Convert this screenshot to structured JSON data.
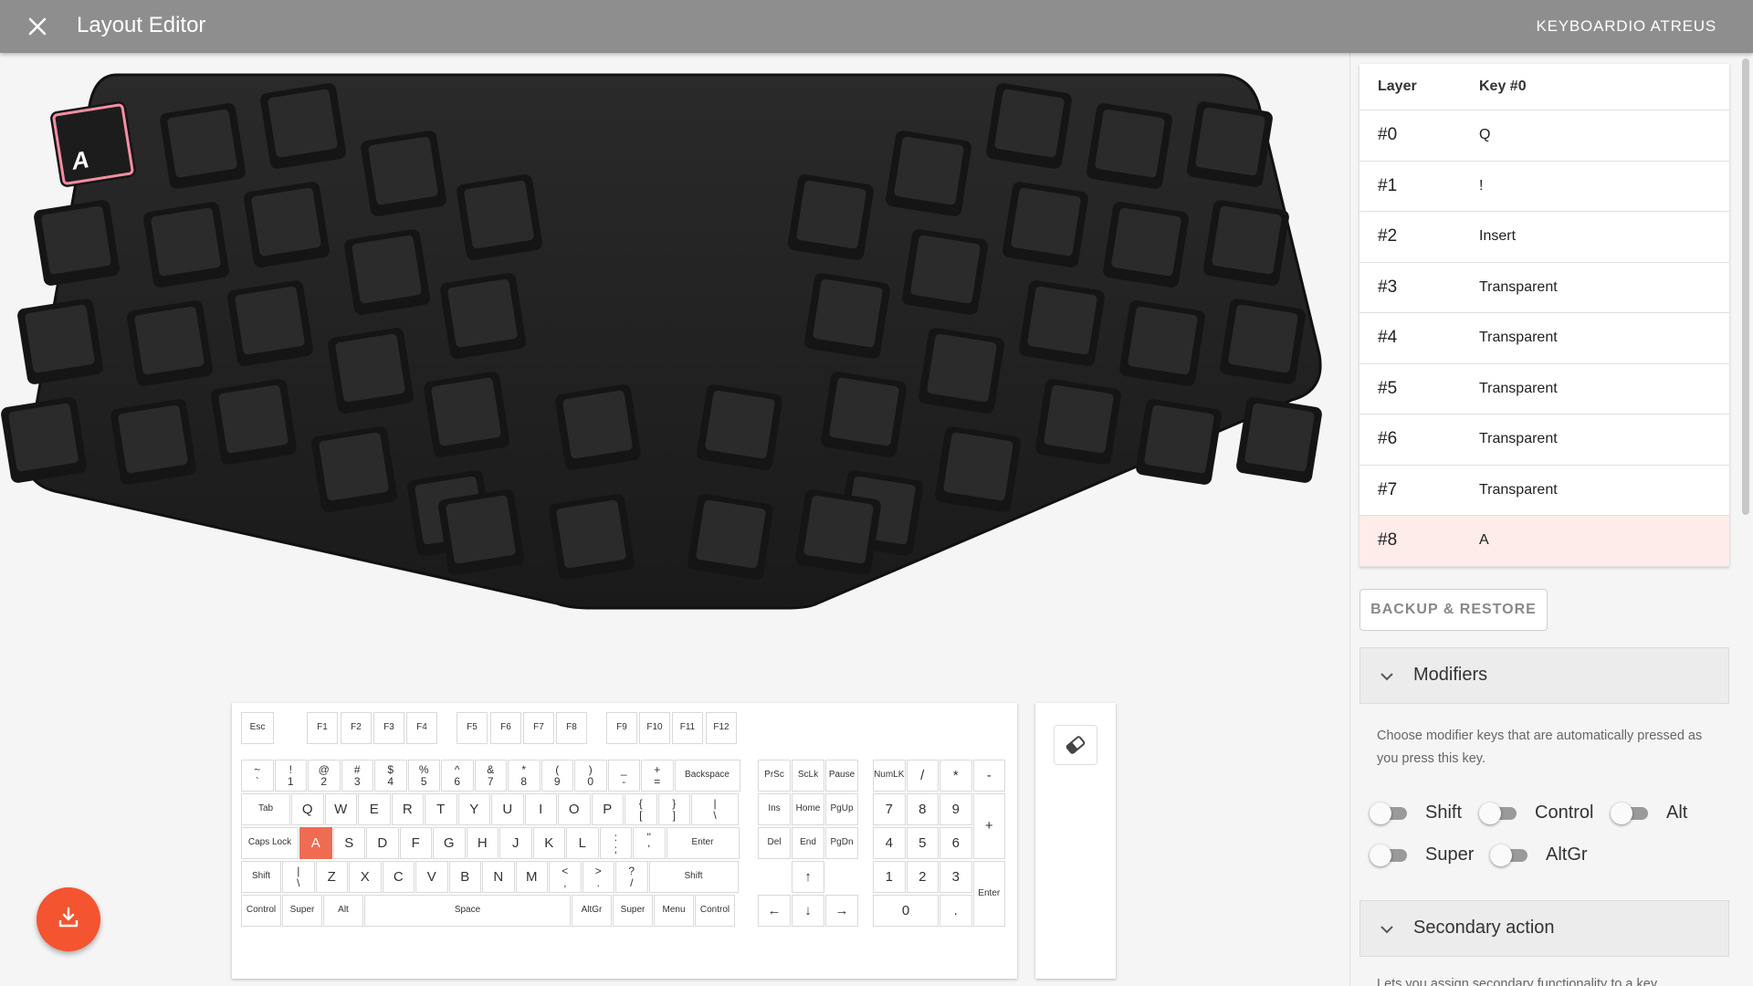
{
  "appbar": {
    "title": "Layout Editor",
    "device": "KEYBOARDIO ATREUS",
    "close_icon": "close-icon",
    "background": "#8e8e8e"
  },
  "layout_keyboard": {
    "selected_key_label": "A",
    "selected_key_color": "#f48fa0",
    "keycap_color": "#2b2b2b"
  },
  "key_selector": {
    "selected_key": "A",
    "accent": "#ef6c53",
    "function_row": [
      "Esc",
      "F1",
      "F2",
      "F3",
      "F4",
      "F5",
      "F6",
      "F7",
      "F8",
      "F9",
      "F10",
      "F11",
      "F12"
    ],
    "number_row": [
      [
        "~",
        "`"
      ],
      [
        "!",
        "1"
      ],
      [
        "@",
        "2"
      ],
      [
        "#",
        "3"
      ],
      [
        "$",
        "4"
      ],
      [
        "%",
        "5"
      ],
      [
        "^",
        "6"
      ],
      [
        "&",
        "7"
      ],
      [
        "*",
        "8"
      ],
      [
        "(",
        "9"
      ],
      [
        ")",
        "0"
      ],
      [
        "_",
        "-"
      ],
      [
        "+",
        "="
      ],
      "Backspace"
    ],
    "tab_row": [
      "Tab",
      "Q",
      "W",
      "E",
      "R",
      "T",
      "Y",
      "U",
      "I",
      "O",
      "P",
      [
        "{",
        "["
      ],
      [
        "}",
        "]"
      ],
      [
        "|",
        "\\"
      ]
    ],
    "caps_row": [
      "Caps Lock",
      "A",
      "S",
      "D",
      "F",
      "G",
      "H",
      "J",
      "K",
      "L",
      [
        ":",
        ";"
      ],
      [
        "\"",
        "'"
      ],
      "Enter"
    ],
    "shift_row": [
      "Shift",
      [
        "|",
        "\\"
      ],
      "Z",
      "X",
      "C",
      "V",
      "B",
      "N",
      "M",
      [
        "<",
        ","
      ],
      [
        ">",
        "."
      ],
      [
        "?",
        "/"
      ],
      "Shift"
    ],
    "bottom_row": [
      "Control",
      "Super",
      "Alt",
      "Space",
      "AltGr",
      "Super",
      "Menu",
      "Control"
    ],
    "nav_top": [
      "PrSc",
      "ScLk",
      "Pause"
    ],
    "nav_mid1": [
      "Ins",
      "Home",
      "PgUp"
    ],
    "nav_mid2": [
      "Del",
      "End",
      "PgDn"
    ],
    "arrows": [
      "↑",
      "←",
      "↓",
      "→"
    ],
    "numpad_row1": [
      "NumLK",
      "/",
      "*",
      "-"
    ],
    "numpad_row2": [
      "7",
      "8",
      "9"
    ],
    "numpad_row3": [
      "4",
      "5",
      "6"
    ],
    "numpad_plus": "+",
    "numpad_row4": [
      "1",
      "2",
      "3"
    ],
    "numpad_enter": "Enter",
    "numpad_row5": [
      "0",
      "."
    ]
  },
  "tools": {
    "eraser_icon": "eraser-icon"
  },
  "fab": {
    "icon": "download-icon",
    "color": "#f4542f"
  },
  "sidebar": {
    "table": {
      "headers": [
        "Layer",
        "Key #0"
      ],
      "rows": [
        {
          "layer": "#0",
          "key": "Q"
        },
        {
          "layer": "#1",
          "key": "!"
        },
        {
          "layer": "#2",
          "key": "Insert"
        },
        {
          "layer": "#3",
          "key": "Transparent"
        },
        {
          "layer": "#4",
          "key": "Transparent"
        },
        {
          "layer": "#5",
          "key": "Transparent"
        },
        {
          "layer": "#6",
          "key": "Transparent"
        },
        {
          "layer": "#7",
          "key": "Transparent"
        },
        {
          "layer": "#8",
          "key": "A",
          "selected": true
        }
      ]
    },
    "backup_label": "BACKUP & RESTORE",
    "modifiers": {
      "title": "Modifiers",
      "description": "Choose modifier keys that are automatically pressed as you press this key.",
      "toggles": [
        {
          "label": "Shift",
          "on": false
        },
        {
          "label": "Control",
          "on": false
        },
        {
          "label": "Alt",
          "on": false
        },
        {
          "label": "Super",
          "on": false
        },
        {
          "label": "AltGr",
          "on": false
        }
      ]
    },
    "secondary": {
      "title": "Secondary action",
      "description": "Lets you assign secondary functionality to a key."
    }
  }
}
